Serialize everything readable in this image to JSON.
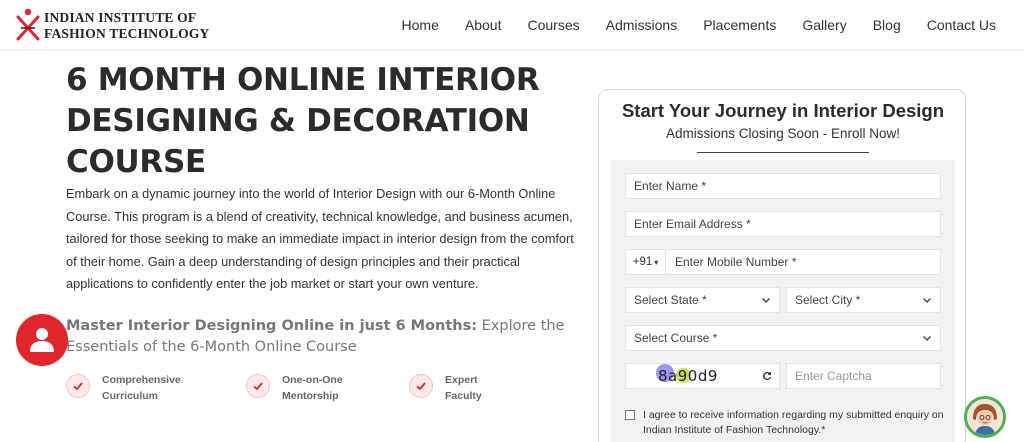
{
  "logo": {
    "line1": "INDIAN INSTITUTE OF",
    "line2": "FASHION TECHNOLOGY"
  },
  "nav": {
    "items": [
      "Home",
      "About",
      "Courses",
      "Admissions",
      "Placements",
      "Gallery",
      "Blog",
      "Contact Us"
    ]
  },
  "hero": {
    "title": "6 MONTH ONLINE INTERIOR DESIGNING & DECORATION COURSE",
    "description": "Embark on a dynamic journey into the world of Interior Design with our 6-Month Online Course. This program is a blend of creativity, technical knowledge, and business acumen, tailored for those seeking to make an immediate impact in interior design from the comfort of their home. Gain a deep understanding of design principles and their practical applications to confidently enter the job market or start your own venture."
  },
  "subheading": {
    "strong": "Master Interior Designing Online in just 6 Months:",
    "rest": " Explore the Essentials of the 6-Month Online Course"
  },
  "features": [
    {
      "line1": "Comprehensive",
      "line2": "Curriculum"
    },
    {
      "line1": "One-on-One",
      "line2": "Mentorship"
    },
    {
      "line1": "Expert",
      "line2": "Faculty"
    }
  ],
  "form": {
    "title": "Start Your Journey in Interior Design",
    "subtitle": "Admissions Closing Soon - Enroll Now!",
    "name_placeholder": "Enter Name *",
    "email_placeholder": "Enter Email Address *",
    "country_code": "+91",
    "mobile_placeholder": "Enter Mobile Number *",
    "state_label": "Select State *",
    "city_label": "Select City *",
    "course_label": "Select Course *",
    "captcha_code": "8a90d9",
    "captcha_placeholder": "Enter Captcha",
    "consent_text": "I agree to receive information regarding my submitted enquiry on Indian Institute of Fashion Technology.*"
  },
  "colors": {
    "brand_red": "#e0252c",
    "chat_ring": "#4caf50"
  }
}
